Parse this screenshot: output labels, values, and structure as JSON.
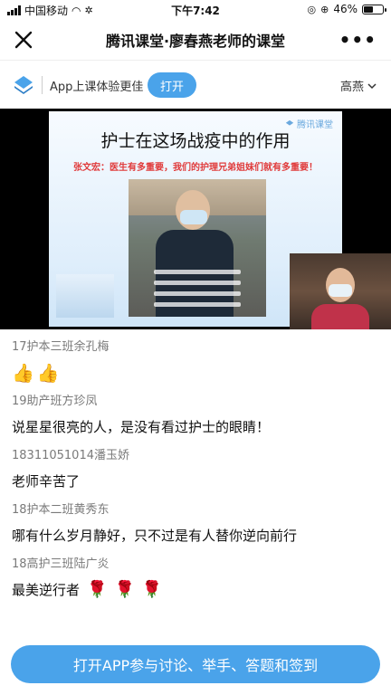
{
  "status_bar": {
    "carrier": "中国移动",
    "time": "下午7:42",
    "battery": "46%",
    "battery_level": 0.46
  },
  "nav": {
    "title": "腾讯课堂·廖春燕老师的课堂",
    "close_icon": "close-icon",
    "more_icon": "more-icon"
  },
  "banner": {
    "text": "App上课体验更佳",
    "open_label": "打开",
    "user_name": "高燕"
  },
  "video": {
    "slide_title": "护士在这场战疫中的作用",
    "slide_quote": "张文宏：医生有多重要，我们的护理兄弟姐妹们就有多重要！",
    "watermark": "腾讯课堂"
  },
  "comments": [
    {
      "author": "17护本三班余孔梅",
      "text": "",
      "emoji": [
        "thumbs-up",
        "thumbs-up"
      ]
    },
    {
      "author": "19助产班方珍凤",
      "text": "说星星很亮的人，是没有看过护士的眼睛！",
      "emoji": []
    },
    {
      "author": "18311051014潘玉娇",
      "text": "老师辛苦了",
      "emoji": []
    },
    {
      "author": "18护本二班黄秀东",
      "text": "哪有什么岁月静好，只不过是有人替你逆向前行",
      "emoji": []
    },
    {
      "author": "18高护三班陆广炎",
      "text": "最美逆行者",
      "emoji": [
        "rose",
        "rose",
        "rose"
      ]
    }
  ],
  "cta": {
    "label": "打开APP参与讨论、举手、答题和签到"
  },
  "colors": {
    "accent": "#4aa3ea",
    "quote_red": "#e03a3a"
  }
}
